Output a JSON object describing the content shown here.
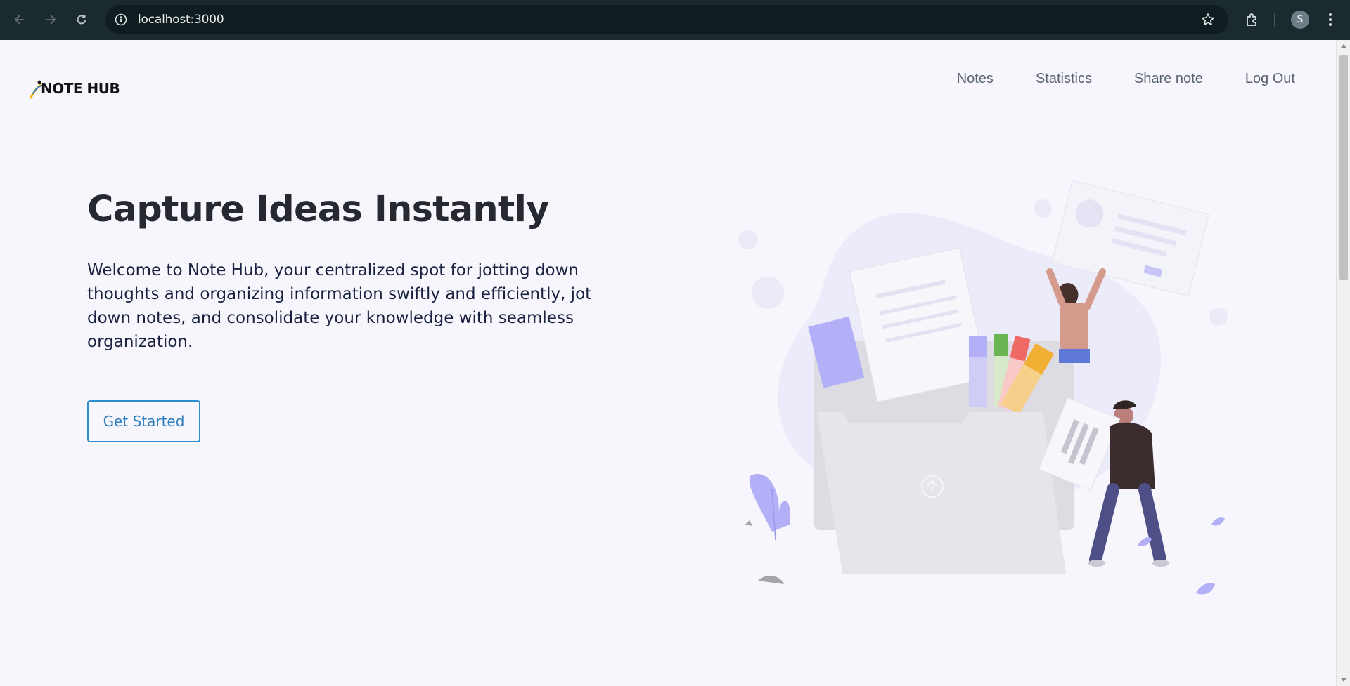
{
  "browser": {
    "url": "localhost:3000",
    "profile_initial": "S",
    "icons": [
      "back-icon",
      "forward-icon",
      "reload-icon",
      "site-info-icon",
      "bookmark-star-icon",
      "extensions-icon",
      "menu-icon"
    ]
  },
  "header": {
    "logo_text": "NOTE HUB",
    "nav": [
      {
        "label": "Notes"
      },
      {
        "label": "Statistics"
      },
      {
        "label": "Share note"
      },
      {
        "label": "Log Out"
      }
    ]
  },
  "hero": {
    "title": "Capture Ideas Instantly",
    "description": "Welcome to Note Hub, your centralized spot for jotting down thoughts and organizing information swiftly and efficiently, jot down notes, and consolidate your knowledge with seamless organization.",
    "cta_label": "Get Started"
  },
  "colors": {
    "accent": "#2e8fd0",
    "illustration_purple": "#b3b0f7",
    "illustration_folder": "#e6e6ea"
  }
}
